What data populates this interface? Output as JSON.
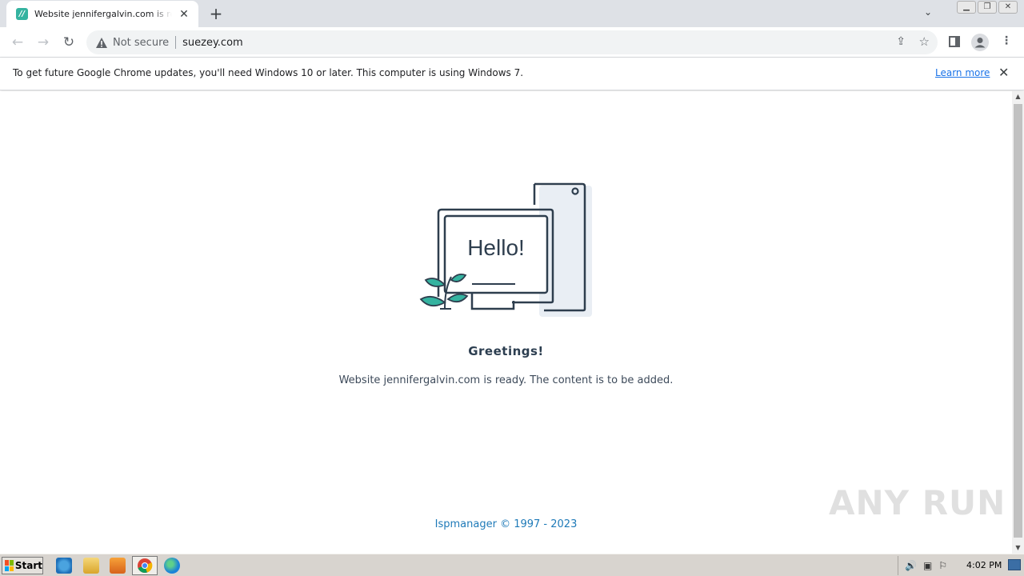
{
  "browser": {
    "tab": {
      "title": "Website jennifergalvin.com is ready. The content is to be added."
    },
    "address_bar": {
      "security_label": "Not secure",
      "url": "suezey.com"
    }
  },
  "infobar": {
    "message": "To get future Google Chrome updates, you'll need Windows 10 or later. This computer is using Windows 7.",
    "link": "Learn more"
  },
  "page": {
    "illustration_text": "Hello!",
    "heading": "Greetings!",
    "subtitle": "Website jennifergalvin.com is ready. The content is to be added.",
    "footer": "Ispmanager © 1997 - 2023",
    "watermark": "ANY RUN"
  },
  "taskbar": {
    "start_label": "Start",
    "clock": "4:02 PM"
  },
  "colors": {
    "accent_teal": "#35b3a0",
    "link_blue": "#1a73e8",
    "footer_blue": "#1e7ab8",
    "heading_navy": "#2c3e50"
  },
  "icons": [
    "tab-favicon-icon",
    "close-icon",
    "plus-icon",
    "back-arrow-icon",
    "forward-arrow-icon",
    "reload-icon",
    "warning-icon",
    "share-icon",
    "star-icon",
    "side-panel-icon",
    "profile-icon",
    "kebab-menu-icon",
    "ie-icon",
    "folder-icon",
    "media-player-icon",
    "chrome-icon",
    "edge-icon",
    "speaker-icon",
    "network-icon",
    "flag-icon"
  ]
}
